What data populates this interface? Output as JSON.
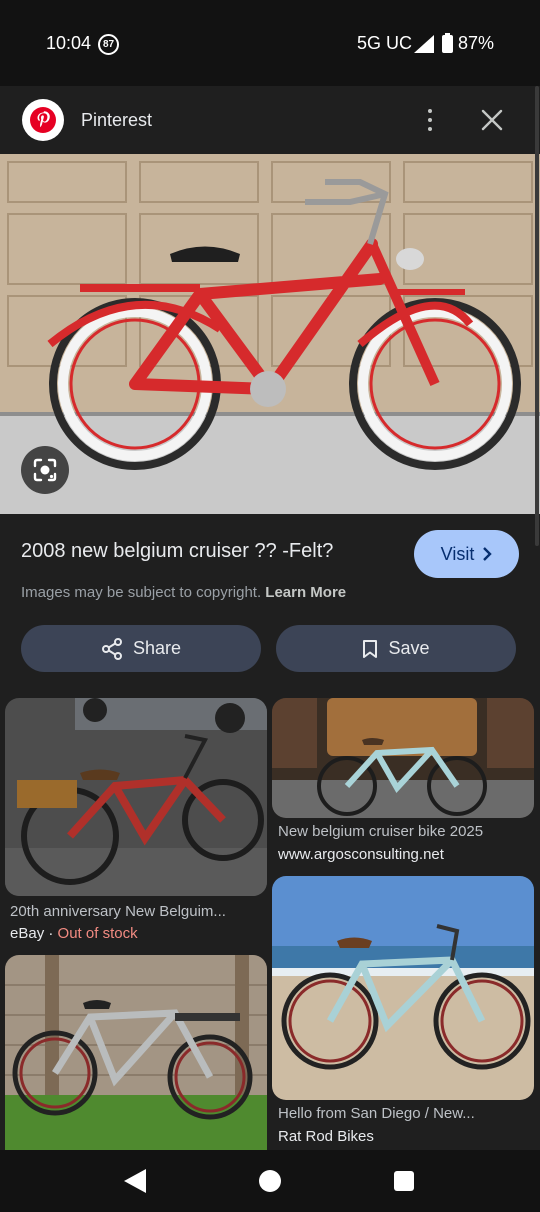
{
  "status": {
    "time": "10:04",
    "notification_count": "87",
    "network": "5G UC",
    "battery": "87%"
  },
  "header": {
    "site_name": "Pinterest"
  },
  "result": {
    "title": "2008 new belgium cruiser ?? -Felt?",
    "visit_label": "Visit",
    "copyright_text": "Images may be subject to copyright.",
    "learn_more": "Learn More"
  },
  "actions": {
    "share_label": "Share",
    "save_label": "Save"
  },
  "related": [
    {
      "caption": "20th anniversary New Belguim...",
      "source": "eBay",
      "separator": " · ",
      "status": "Out of stock"
    },
    {
      "caption": "New belgium cruiser bike 2025",
      "source": "www.argosconsulting.net"
    },
    {
      "caption": "Hello from San Diego / New...",
      "source": "Rat Rod Bikes"
    },
    {
      "caption": "",
      "source": ""
    }
  ],
  "colors": {
    "accent": "#a8c7fa",
    "button_bg": "#3c4456",
    "bike_red": "#d62a2c",
    "out_of_stock": "#f28b82"
  },
  "icons": [
    "pinterest-logo",
    "more-vert-icon",
    "close-icon",
    "lens-icon",
    "chevron-right-icon",
    "share-icon",
    "bookmark-icon"
  ]
}
